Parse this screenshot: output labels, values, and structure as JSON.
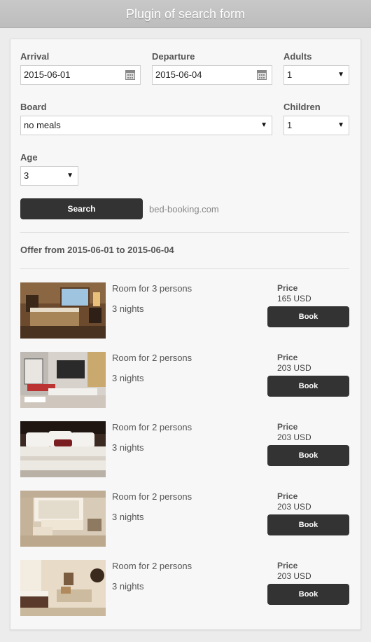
{
  "header": {
    "title": "Plugin of search form"
  },
  "form": {
    "arrival": {
      "label": "Arrival",
      "value": "2015-06-01"
    },
    "departure": {
      "label": "Departure",
      "value": "2015-06-04"
    },
    "adults": {
      "label": "Adults",
      "value": "1"
    },
    "board": {
      "label": "Board",
      "value": "no meals"
    },
    "children": {
      "label": "Children",
      "value": "1"
    },
    "age": {
      "label": "Age",
      "value": "3"
    },
    "search_label": "Search",
    "powered_by": "bed-booking.com"
  },
  "offer": {
    "title": "Offer from 2015-06-01 to 2015-06-04",
    "price_label": "Price",
    "book_label": "Book",
    "rooms": [
      {
        "name": "Room for 3 persons",
        "nights": "3 nights",
        "price": "165 USD"
      },
      {
        "name": "Room for 2 persons",
        "nights": "3 nights",
        "price": "203 USD"
      },
      {
        "name": "Room for 2 persons",
        "nights": "3 nights",
        "price": "203 USD"
      },
      {
        "name": "Room for 2 persons",
        "nights": "3 nights",
        "price": "203 USD"
      },
      {
        "name": "Room for 2 persons",
        "nights": "3 nights",
        "price": "203 USD"
      }
    ]
  },
  "colors": {
    "button": "#333333",
    "header": "#c3c3c3",
    "panel": "#f7f7f7"
  }
}
